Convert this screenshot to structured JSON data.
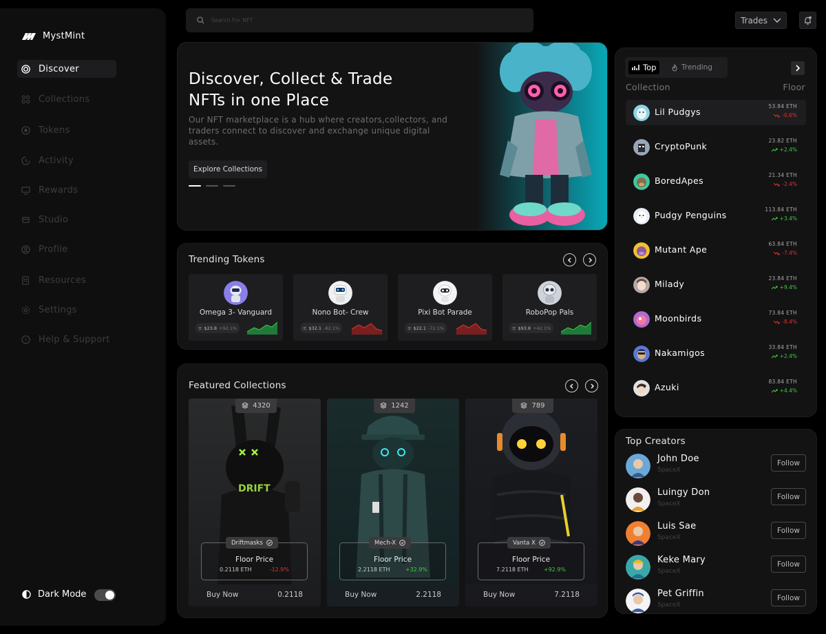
{
  "brand": {
    "name": "MystMint"
  },
  "sidebar": {
    "items": [
      {
        "label": "Discover",
        "icon": "target-icon",
        "active": true
      },
      {
        "label": "Collections",
        "icon": "grid-icon"
      },
      {
        "label": "Tokens",
        "icon": "coin-icon"
      },
      {
        "label": "Activity",
        "icon": "activity-icon"
      },
      {
        "label": "Rewards",
        "icon": "monitor-icon"
      },
      {
        "label": "Studio",
        "icon": "studio-icon"
      },
      {
        "label": "Profile",
        "icon": "user-icon"
      },
      {
        "label": "Resources",
        "icon": "resources-icon"
      },
      {
        "label": "Settings",
        "icon": "gear-icon"
      },
      {
        "label": "Help & Support",
        "icon": "help-icon"
      }
    ],
    "dark_mode": {
      "label": "Dark Mode",
      "enabled": true
    }
  },
  "header": {
    "search_placeholder": "Search For NFT",
    "trades_label": "Trades"
  },
  "hero": {
    "title_line1": "Discover, Collect & Trade",
    "title_line2": "NFTs in one Place",
    "description": "Our NFT marketplace is a hub where creators,collectors, and traders connect to discover and exchange unique digital assets.",
    "button_label": "Explore Collections"
  },
  "trending": {
    "title": "Trending Tokens",
    "tokens": [
      {
        "name": "Omega 3- Vanguard",
        "price": "$23.8",
        "pct": "+92.1%",
        "trend": "up"
      },
      {
        "name": "Nono Bot- Crew",
        "price": "$32.1",
        "pct": "-82.1%",
        "trend": "down"
      },
      {
        "name": "Pixi Bot Parade",
        "price": "$22.1",
        "pct": "-72.1%",
        "trend": "down"
      },
      {
        "name": "RoboPop Pals",
        "price": "$93.8",
        "pct": "+42.1%",
        "trend": "up"
      }
    ]
  },
  "featured": {
    "title": "Featured Collections",
    "floor_label": "Floor Price",
    "buy_label": "Buy Now",
    "cards": [
      {
        "count": "4320",
        "name": "Driftmasks",
        "eth": "0.2118 ETH",
        "change": "-12.9%",
        "trend": "down",
        "buy_price": "0.2118"
      },
      {
        "count": "1242",
        "name": "Mech-X",
        "eth": "2.2118 ETH",
        "change": "+32.9%",
        "trend": "up",
        "buy_price": "2.2118"
      },
      {
        "count": "789",
        "name": "Vanta X",
        "eth": "7.2118 ETH",
        "change": "+92.9%",
        "trend": "up",
        "buy_price": "7.2118"
      }
    ]
  },
  "top_collections": {
    "tab_top": "Top",
    "tab_trending": "Trending",
    "col_collection": "Collection",
    "col_floor": "Floor",
    "rows": [
      {
        "name": "Lil Pudgys",
        "value": "53.84  ETH",
        "change": "-0.6%",
        "trend": "down",
        "active": true
      },
      {
        "name": "CryptoPunk",
        "value": "23.82  ETH",
        "change": "+2.4%",
        "trend": "up"
      },
      {
        "name": "BoredApes",
        "value": "21.34  ETH",
        "change": "-2.4%",
        "trend": "down"
      },
      {
        "name": "Pudgy Penguins",
        "value": "113.84  ETH",
        "change": "+3.4%",
        "trend": "up"
      },
      {
        "name": "Mutant Ape",
        "value": "63.84  ETH",
        "change": "-7.4%",
        "trend": "down"
      },
      {
        "name": "Milady",
        "value": "23.84  ETH",
        "change": "+9.4%",
        "trend": "up"
      },
      {
        "name": "Moonbirds",
        "value": "73.84  ETH",
        "change": "-8.4%",
        "trend": "down"
      },
      {
        "name": "Nakamigos",
        "value": "33.84  ETH",
        "change": "+2.4%",
        "trend": "up"
      },
      {
        "name": "Azuki",
        "value": "83.84  ETH",
        "change": "+4.4%",
        "trend": "up"
      }
    ]
  },
  "creators": {
    "title": "Top Creators",
    "follow_label": "Follow",
    "items": [
      {
        "name": "John Doe",
        "org": "SpaceX"
      },
      {
        "name": "Luingy Don",
        "org": "SpaceX"
      },
      {
        "name": "Luis Sae",
        "org": "SpaceX"
      },
      {
        "name": "Keke Mary",
        "org": "SpaceX"
      },
      {
        "name": "Pet Griffin",
        "org": "SpaceX"
      }
    ]
  }
}
